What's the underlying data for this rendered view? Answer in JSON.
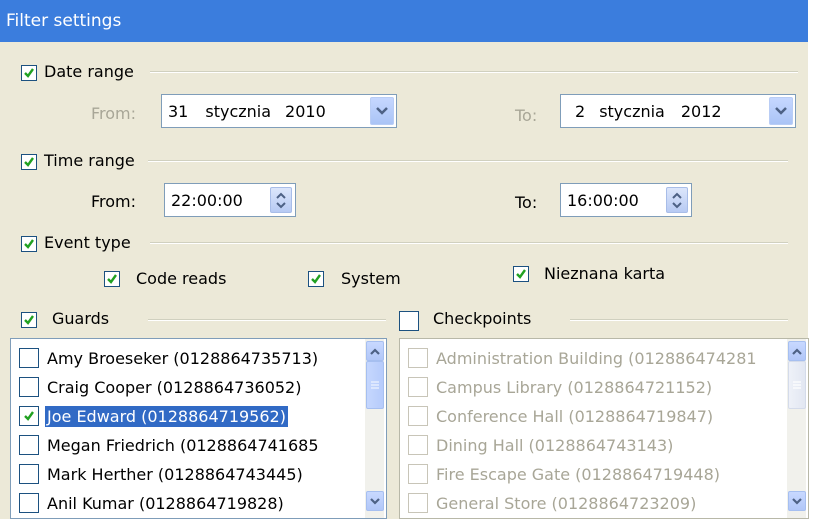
{
  "title": "Filter settings",
  "date_range": {
    "label": "Date range",
    "checked": true,
    "from_label": "From:",
    "to_label": "To:",
    "from": {
      "day": "31",
      "month": "stycznia",
      "year": "2010"
    },
    "to": {
      "day": "2",
      "month": "stycznia",
      "year": "2012"
    }
  },
  "time_range": {
    "label": "Time range",
    "checked": true,
    "from_label": "From:",
    "to_label": "To:",
    "from": "22:00:00",
    "to": "16:00:00"
  },
  "event_type": {
    "label": "Event type",
    "checked": true,
    "options": [
      {
        "label": "Code reads",
        "checked": true
      },
      {
        "label": "System",
        "checked": true
      },
      {
        "label": "Nieznana karta",
        "checked": true
      }
    ]
  },
  "guards": {
    "label": "Guards",
    "checked": true,
    "items": [
      {
        "label": "Amy Broeseker (0128864735713)",
        "checked": false,
        "selected": false
      },
      {
        "label": "Craig  Cooper (0128864736052)",
        "checked": false,
        "selected": false
      },
      {
        "label": "Joe Edward (0128864719562)",
        "checked": true,
        "selected": true
      },
      {
        "label": "Megan Friedrich (0128864741685",
        "checked": false,
        "selected": false
      },
      {
        "label": "Mark Herther (0128864743445)",
        "checked": false,
        "selected": false
      },
      {
        "label": "Anil Kumar (0128864719828)",
        "checked": false,
        "selected": false
      }
    ]
  },
  "checkpoints": {
    "label": "Checkpoints",
    "checked": false,
    "items": [
      {
        "label": "Administration Building (012886474281"
      },
      {
        "label": "Campus Library (0128864721152)"
      },
      {
        "label": "Conference Hall (0128864719847)"
      },
      {
        "label": "Dining Hall (0128864743143)"
      },
      {
        "label": "Fire Escape Gate (0128864719448)"
      },
      {
        "label": "General Store (0128864723209)"
      }
    ]
  },
  "colors": {
    "titlebar": "#3b7ddd",
    "selection": "#316ac5",
    "background": "#ece9d8"
  }
}
